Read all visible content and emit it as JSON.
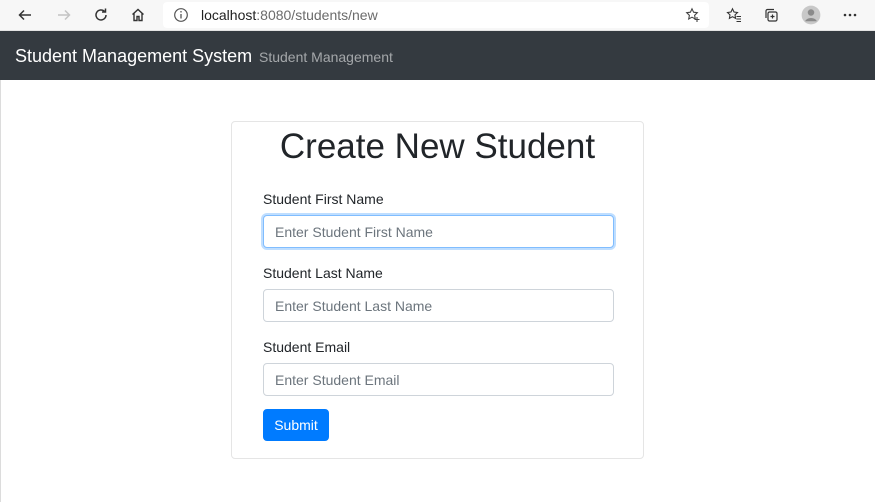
{
  "browser": {
    "url_host": "localhost",
    "url_rest": ":8080/students/new",
    "icons": [
      "back-arrow-icon",
      "forward-arrow-icon",
      "reload-icon",
      "home-icon",
      "info-icon",
      "add-favorite-icon",
      "favorites-icon",
      "collections-icon",
      "profile-avatar-icon",
      "more-menu-icon"
    ]
  },
  "navbar": {
    "brand": "Student Management System",
    "link": "Student Management"
  },
  "form": {
    "title": "Create New Student",
    "first_name_label": "Student First Name",
    "first_name_placeholder": "Enter Student First Name",
    "last_name_label": "Student Last Name",
    "last_name_placeholder": "Enter Student Last Name",
    "email_label": "Student Email",
    "email_placeholder": "Enter Student Email",
    "submit_label": "Submit"
  },
  "colors": {
    "navbar_bg": "#343a40",
    "primary": "#007bff",
    "focus_border": "#80bdff"
  }
}
